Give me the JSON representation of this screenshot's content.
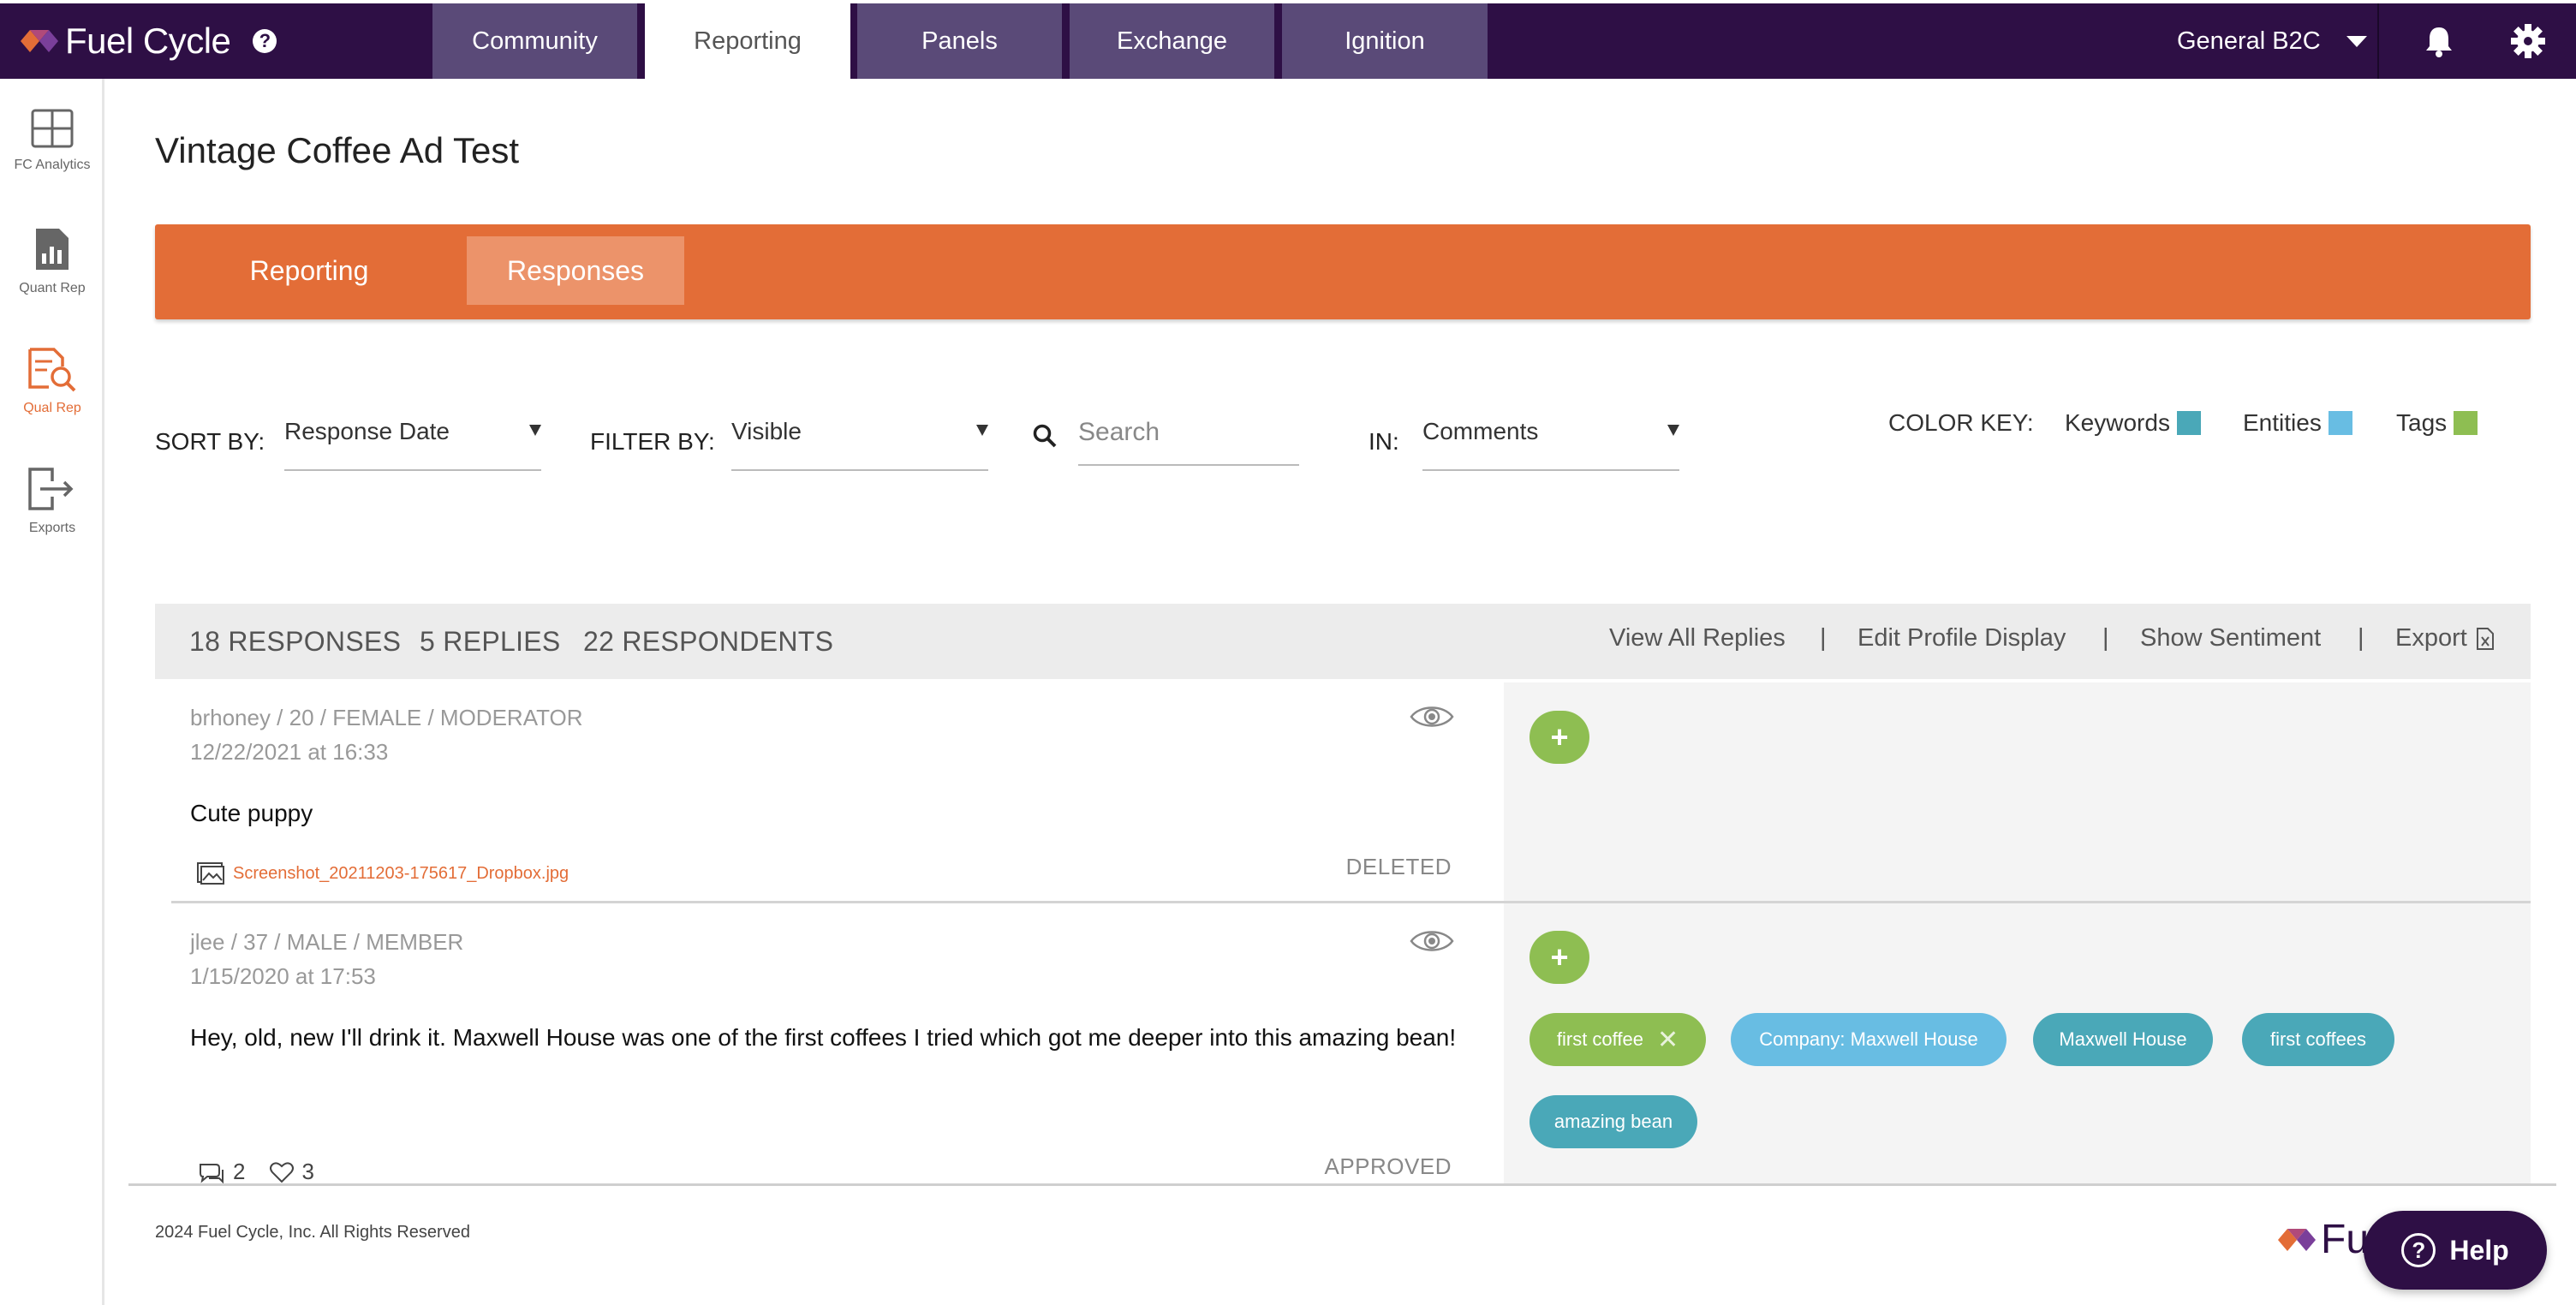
{
  "app": {
    "brand": "Fuel Cycle",
    "nav_tabs": [
      {
        "label": "Community"
      },
      {
        "label": "Reporting"
      },
      {
        "label": "Panels"
      },
      {
        "label": "Exchange"
      },
      {
        "label": "Ignition"
      }
    ],
    "tenant": "General B2C",
    "colors": {
      "nav_bg": "#2e0f45",
      "accent": "#e36d37",
      "tag_green": "#8ebe52",
      "entity_blue": "#68bde3",
      "keyword_teal": "#4aa8b8"
    }
  },
  "sidebar": {
    "items": [
      {
        "label": "FC Analytics",
        "icon": "grid-icon"
      },
      {
        "label": "Quant Rep",
        "icon": "bar-chart-document-icon"
      },
      {
        "label": "Qual Rep",
        "icon": "search-document-icon"
      },
      {
        "label": "Exports",
        "icon": "export-icon"
      }
    ]
  },
  "page": {
    "title": "Vintage Coffee Ad Test",
    "subtabs": [
      {
        "label": "Reporting"
      },
      {
        "label": "Responses"
      }
    ]
  },
  "filters": {
    "sort_label": "SORT BY:",
    "sort_value": "Response Date",
    "filter_label": "FILTER BY:",
    "filter_value": "Visible",
    "search_placeholder": "Search",
    "in_label": "IN:",
    "in_value": "Comments",
    "color_key_label": "COLOR KEY:",
    "color_key": [
      {
        "label": "Keywords",
        "color": "#4aa8b8"
      },
      {
        "label": "Entities",
        "color": "#68bde3"
      },
      {
        "label": "Tags",
        "color": "#8ebe52"
      }
    ]
  },
  "stats": {
    "responses": "18 RESPONSES",
    "replies": "5 REPLIES",
    "respondents": "22 RESPONDENTS",
    "actions": [
      "View All Replies",
      "Edit Profile Display",
      "Show Sentiment",
      "Export"
    ],
    "separator": "|"
  },
  "responses": [
    {
      "meta": "brhoney / 20 / FEMALE / MODERATOR",
      "date": "12/22/2021 at 16:33",
      "text": "Cute puppy",
      "attachment": "Screenshot_20211203-175617_Dropbox.jpg",
      "status": "DELETED",
      "tags": []
    },
    {
      "meta": "jlee / 37 / MALE / MEMBER",
      "date": "1/15/2020 at 17:53",
      "text": "Hey, old, new I'll drink it. Maxwell House was one of the first coffees I tried which got me deeper into this amazing bean!",
      "status": "APPROVED",
      "comments": "2",
      "likes": "3",
      "tags": [
        {
          "label": "first coffee",
          "kind": "tag"
        },
        {
          "label": "Company: Maxwell House",
          "kind": "entity"
        },
        {
          "label": "Maxwell House",
          "kind": "keyword"
        },
        {
          "label": "first coffees",
          "kind": "keyword"
        },
        {
          "label": "amazing bean",
          "kind": "keyword"
        }
      ]
    }
  ],
  "plus_label": "+",
  "footer": {
    "copyright": "2024 Fuel Cycle, Inc. All Rights Reserved",
    "logo_text": "Fu",
    "help_label": "Help",
    "help_icon": "?"
  }
}
